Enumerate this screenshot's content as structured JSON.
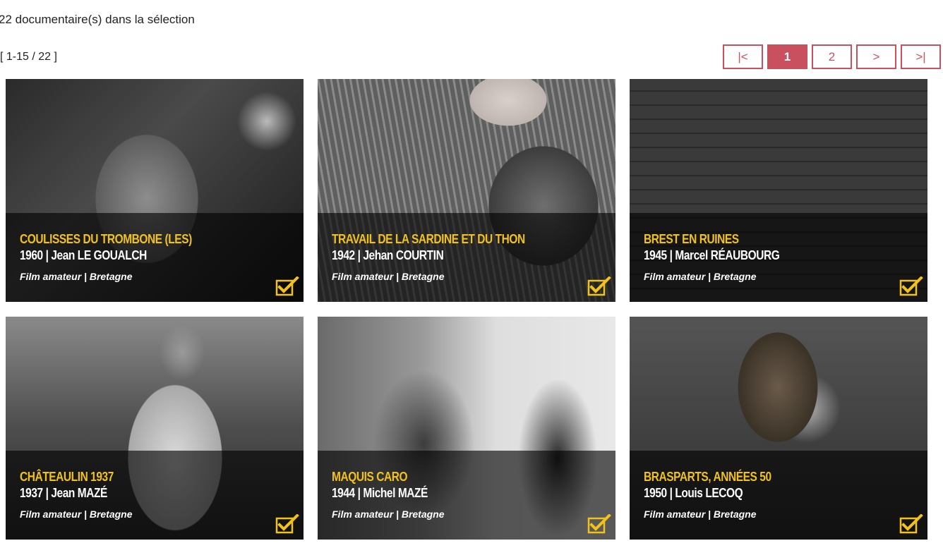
{
  "selection": {
    "count_text": "22 documentaire(s) dans la sélection",
    "range_text": "[ 1-15 / 22 ]"
  },
  "pagination": {
    "first": "|<",
    "pages": [
      "1",
      "2"
    ],
    "current": "1",
    "next": ">",
    "last": ">|"
  },
  "accent_color": "#c9505f",
  "title_color": "#f2c21b",
  "documentaries": [
    {
      "title": "COULISSES DU TROMBONE (LES)",
      "meta": "1960 | Jean LE GOUALCH",
      "tags": "Film amateur | Bretagne",
      "selected_icon": "checkbox-checked-icon"
    },
    {
      "title": "TRAVAIL DE LA SARDINE ET DU THON",
      "meta": "1942 | Jehan COURTIN",
      "tags": "Film amateur | Bretagne",
      "selected_icon": "checkbox-checked-icon"
    },
    {
      "title": "BREST EN RUINES",
      "meta": "1945 | Marcel RÉAUBOURG",
      "tags": "Film amateur | Bretagne",
      "selected_icon": "checkbox-checked-icon"
    },
    {
      "title": "CHÂTEAULIN 1937",
      "meta": "1937 | Jean MAZÉ",
      "tags": "Film amateur | Bretagne",
      "selected_icon": "checkbox-checked-icon"
    },
    {
      "title": "MAQUIS CARO",
      "meta": "1944 | Michel MAZÉ",
      "tags": "Film amateur | Bretagne",
      "selected_icon": "checkbox-checked-icon"
    },
    {
      "title": "BRASPARTS, ANNÉES 50",
      "meta": "1950 | Louis LECOQ",
      "tags": "Film amateur | Bretagne",
      "selected_icon": "checkbox-checked-icon"
    }
  ]
}
